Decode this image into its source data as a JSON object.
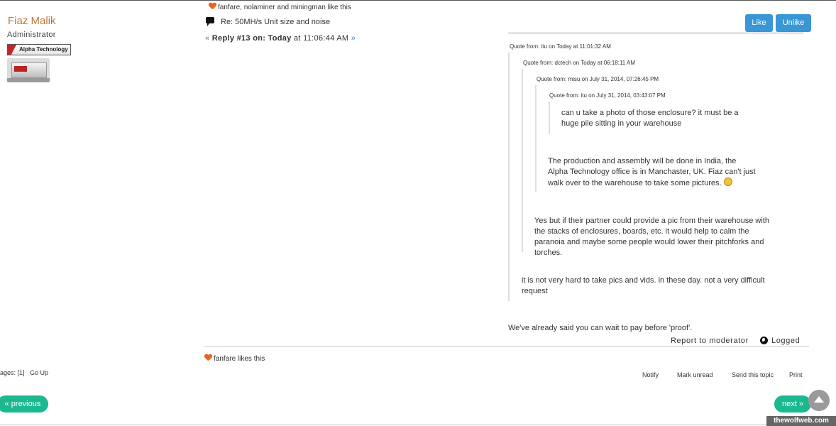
{
  "poster": {
    "name": "Fiaz Malik",
    "role": "Administrator",
    "badge_text": "Alpha Technology"
  },
  "post": {
    "likes_top": "fanfare, nolaminer and miningman like this",
    "subject": "Re: 50MH/s Unit size and noise",
    "reply_prefix": "«",
    "reply_label": "Reply #13 on: Today",
    "reply_time": "at 11:06:44 AM",
    "reply_suffix": "»",
    "like_button": "Like",
    "unlike_button": "Unlike",
    "quotes": [
      {
        "header": "Quote from: itu on Today at 11:01:32 AM",
        "text": "it is not very hard to take pics and vids. in these day. not a very difficult request"
      },
      {
        "header": "Quote from: dctech on Today at 06:18:11 AM",
        "text": "Yes but if their partner could provide a pic from their warehouse with the stacks of enclosures, boards, etc. it would help to calm the paranoia and maybe some people would lower their pitchforks and torches."
      },
      {
        "header": "Quote from: misu on July 31, 2014, 07:26:45 PM",
        "text": "The production and assembly will be done in India, the Alpha Technology office is in Manchaster, UK. Fiaz can't just walk over to the warehouse to take some pictures."
      },
      {
        "header": "Quote from: itu on July 31, 2014, 03:43:07 PM",
        "text": "can u take a photo of those enclosure? it must be a huge pile sitting in your warehouse"
      }
    ],
    "body_text": "We've already said you can wait to pay before 'proof'.",
    "report_link": "Report to moderator",
    "logged_label": "Logged",
    "likes_bottom": "fanfare likes this"
  },
  "footer": {
    "pages_label": "Pages:",
    "current_page": "[1]",
    "go_up": "Go Up",
    "actions": [
      "Notify",
      "Mark unread",
      "Send this topic",
      "Print"
    ],
    "prev_label": "« previous",
    "next_label": "next »"
  },
  "watermark": "thewolfweb.com",
  "colors": {
    "accent_blue": "#3a96d4",
    "accent_green": "#1cb88f",
    "name_orange": "#c0773a",
    "heart": "#e8641f"
  }
}
